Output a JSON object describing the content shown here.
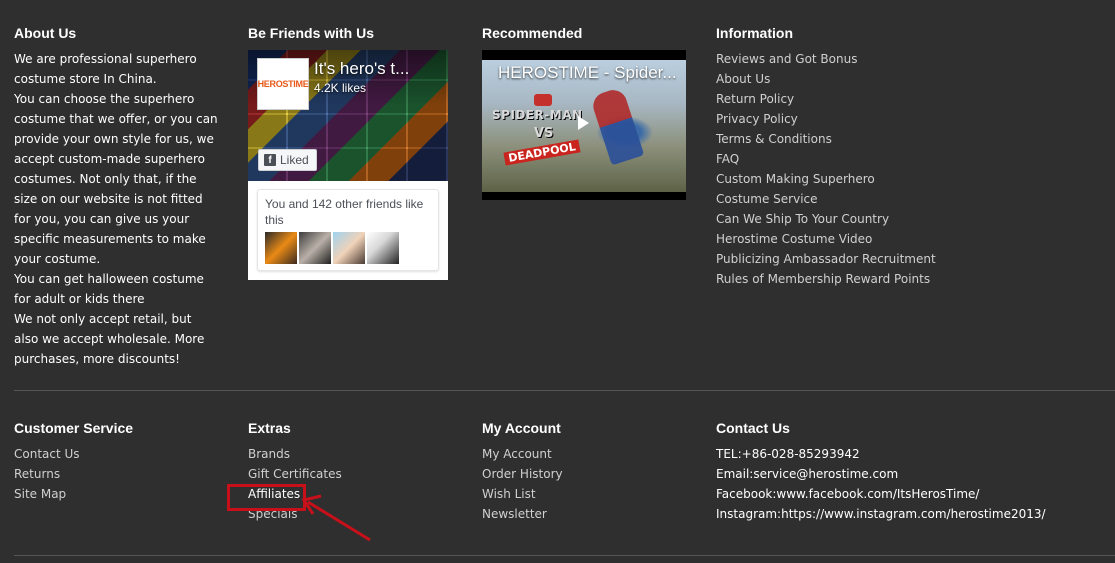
{
  "about": {
    "heading": "About Us",
    "lines": [
      "We are professional superhero costume store In China.",
      "You can choose the superhero costume that we offer, or you can provide your own style for us, we accept custom-made superhero costumes. Not only that, if the size on our website is not fitted for you, you can give us your specific measurements to make your costume.",
      "You can get halloween costume for adult or kids there",
      "We not only accept retail, but also we accept wholesale. More purchases, more discounts!"
    ]
  },
  "friends": {
    "heading": "Be Friends with Us",
    "page_name": "It's hero's t...",
    "likes": "4.2K likes",
    "liked_label": "Liked",
    "friends_text": "You and 142 other friends like this",
    "logo_text": "HEROSTIME"
  },
  "recommended": {
    "heading": "Recommended",
    "video_title": "HEROSTIME - Spider...",
    "overlay_spiderman": "SPIDER-MAN",
    "overlay_vs": "VS",
    "overlay_deadpool": "DEADPOOL"
  },
  "information": {
    "heading": "Information",
    "links": [
      "Reviews and Got Bonus",
      "About Us",
      "Return Policy",
      "Privacy Policy",
      "Terms & Conditions",
      "FAQ",
      "Custom Making Superhero Costume Service",
      "Can We Ship To Your Country",
      "Herostime Costume Video",
      "Publicizing Ambassador Recruitment",
      "Rules of Membership Reward Points"
    ]
  },
  "customer_service": {
    "heading": "Customer Service",
    "links": [
      "Contact Us",
      "Returns",
      "Site Map"
    ]
  },
  "extras": {
    "heading": "Extras",
    "links": [
      "Brands",
      "Gift Certificates",
      "Affiliates",
      "Specials"
    ]
  },
  "my_account": {
    "heading": "My Account",
    "links": [
      "My Account",
      "Order History",
      "Wish List",
      "Newsletter"
    ]
  },
  "contact": {
    "heading": "Contact Us",
    "lines": [
      "TEL:+86-028-85293942",
      "Email:service@herostime.com",
      "Facebook:www.facebook.com/ItsHerosTime/",
      "Instagram:https://www.instagram.com/herostime2013/"
    ]
  },
  "colors": {
    "background": "#2f2f2f",
    "link": "#d0d0d0",
    "divider": "#555555",
    "annotation": "#c8101a"
  }
}
